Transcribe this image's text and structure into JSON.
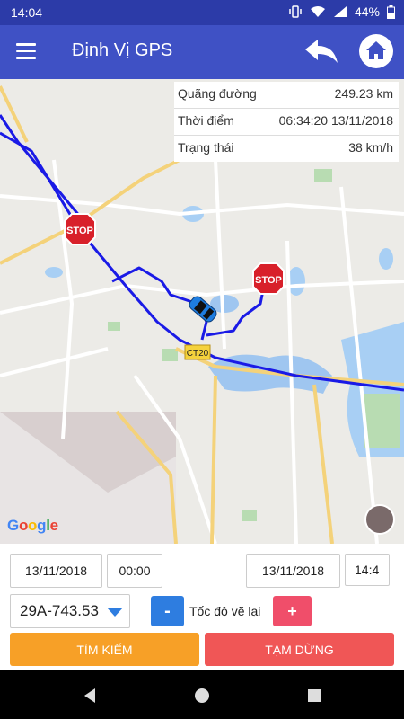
{
  "status": {
    "time": "14:04",
    "battery": "44%"
  },
  "appbar": {
    "title": "Định Vị GPS"
  },
  "info": {
    "rows": [
      {
        "label": "Quãng đường",
        "value": "249.23 km"
      },
      {
        "label": "Thời điểm",
        "value": "06:34:20 13/11/2018"
      },
      {
        "label": "Trạng thái",
        "value": "38 km/h"
      }
    ]
  },
  "map": {
    "sign_text": "STOP",
    "road_label": "CT20",
    "attribution": "Google",
    "route_color": "#1a1ae6"
  },
  "controls": {
    "from_date": "13/11/2018",
    "from_time": "00:00",
    "to_date": "13/11/2018",
    "to_time": "14:4",
    "vehicle": "29A-743.53",
    "minus_label": "-",
    "speed_label": "Tốc độ vẽ lại",
    "plus_label": "+",
    "search_label": "TÌM KIẾM",
    "pause_label": "TẠM DỪNG",
    "colors": {
      "search": "#f7a027",
      "pause": "#f05656",
      "minus": "#2e7de0",
      "plus": "#f04e6a"
    }
  }
}
